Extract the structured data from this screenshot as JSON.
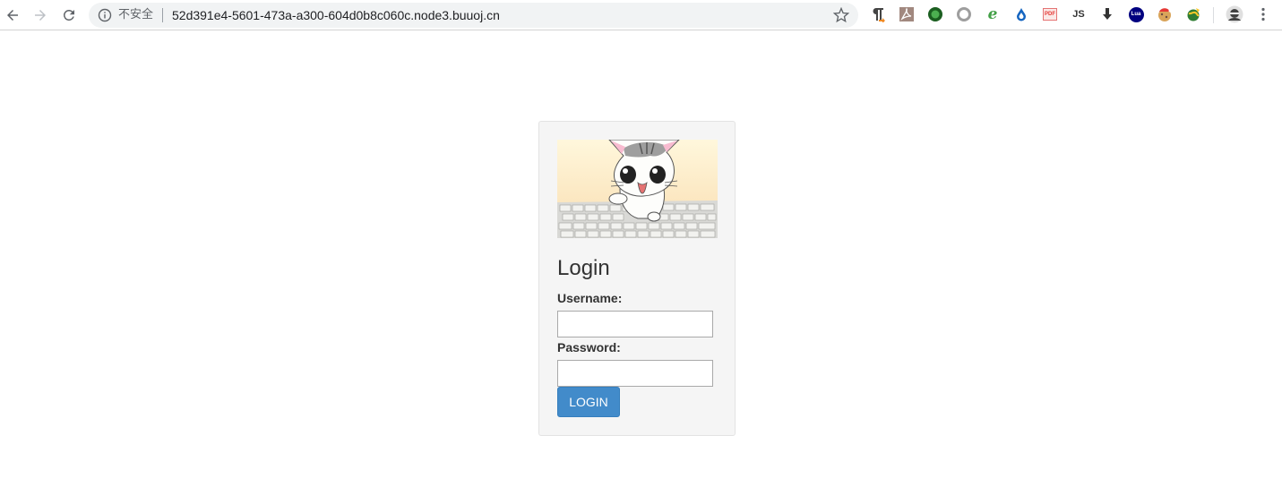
{
  "browser": {
    "security_label": "不安全",
    "url": "52d391e4-5601-473a-a300-604d0b8c060c.node3.buuoj.cn",
    "extensions": [
      {
        "name": "pilcrow-icon",
        "text": ""
      },
      {
        "name": "pdf-icon",
        "text": ""
      },
      {
        "name": "green-orb-icon",
        "text": ""
      },
      {
        "name": "ring-icon",
        "text": ""
      },
      {
        "name": "e-icon",
        "text": "e"
      },
      {
        "name": "drop-icon",
        "text": ""
      },
      {
        "name": "pdf-badge-icon",
        "text": "PDF"
      },
      {
        "name": "js-icon",
        "text": "JS"
      },
      {
        "name": "download-arrow-icon",
        "text": ""
      },
      {
        "name": "lua-icon",
        "text": "Lua"
      },
      {
        "name": "cookie-icon",
        "text": ""
      },
      {
        "name": "globe-icon",
        "text": ""
      }
    ]
  },
  "login": {
    "title": "Login",
    "username_label": "Username:",
    "username_value": "",
    "password_label": "Password:",
    "password_value": "",
    "button_label": "LOGIN"
  }
}
